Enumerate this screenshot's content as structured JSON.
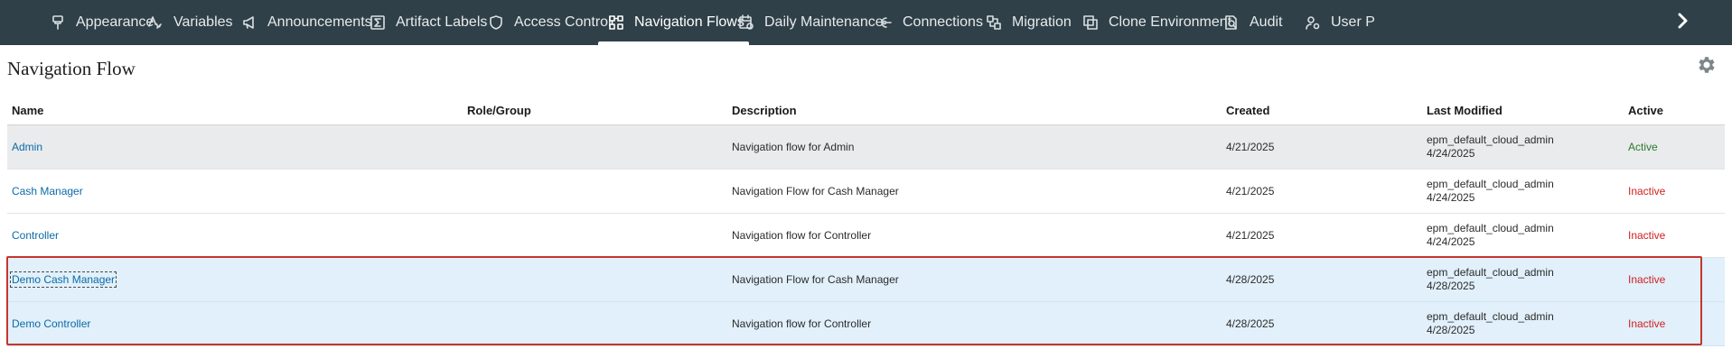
{
  "topnav": {
    "tabs": [
      {
        "label": "Appearance",
        "icon": "paint-brush-icon"
      },
      {
        "label": "Variables",
        "icon": "variables-icon"
      },
      {
        "label": "Announcements",
        "icon": "megaphone-icon"
      },
      {
        "label": "Artifact Labels",
        "icon": "sigma-icon"
      },
      {
        "label": "Access Control",
        "icon": "shield-icon"
      },
      {
        "label": "Navigation Flows",
        "icon": "navigation-grid-icon",
        "selected": true
      },
      {
        "label": "Daily Maintenance",
        "icon": "calendar-gear-icon"
      },
      {
        "label": "Connections",
        "icon": "connections-icon"
      },
      {
        "label": "Migration",
        "icon": "migration-icon"
      },
      {
        "label": "Clone Environment",
        "icon": "clone-icon"
      },
      {
        "label": "Audit",
        "icon": "audit-icon"
      },
      {
        "label": "User P",
        "icon": "user-gear-icon"
      }
    ],
    "scroll_icon": "chevron-right-icon"
  },
  "page": {
    "title": "Navigation Flow",
    "settings_icon": "gear-icon"
  },
  "table": {
    "columns": {
      "name": "Name",
      "role": "Role/Group",
      "description": "Description",
      "created": "Created",
      "modified": "Last Modified",
      "active": "Active"
    },
    "rows": [
      {
        "name": "Admin",
        "role": "",
        "description": "Navigation flow for Admin",
        "created": "4/21/2025",
        "modified_by": "epm_default_cloud_admin",
        "modified_date": "4/24/2025",
        "active": "Active"
      },
      {
        "name": "Cash Manager",
        "role": "",
        "description": "Navigation Flow for Cash Manager",
        "created": "4/21/2025",
        "modified_by": "epm_default_cloud_admin",
        "modified_date": "4/24/2025",
        "active": "Inactive"
      },
      {
        "name": "Controller",
        "role": "",
        "description": "Navigation flow for Controller",
        "created": "4/21/2025",
        "modified_by": "epm_default_cloud_admin",
        "modified_date": "4/24/2025",
        "active": "Inactive"
      },
      {
        "name": "Demo Cash Manager",
        "role": "",
        "description": "Navigation Flow for Cash Manager",
        "created": "4/28/2025",
        "modified_by": "epm_default_cloud_admin",
        "modified_date": "4/28/2025",
        "active": "Inactive"
      },
      {
        "name": "Demo Controller",
        "role": "",
        "description": "Navigation flow for Controller",
        "created": "4/28/2025",
        "modified_by": "epm_default_cloud_admin",
        "modified_date": "4/28/2025",
        "active": "Inactive"
      }
    ]
  },
  "colors": {
    "topnav_bg": "#2f4048",
    "link": "#0b6aa8",
    "active": "#2c7a2c",
    "inactive": "#d32020",
    "selection_outline": "#c6352b",
    "selected_row_bg": "#e1f0fb"
  }
}
